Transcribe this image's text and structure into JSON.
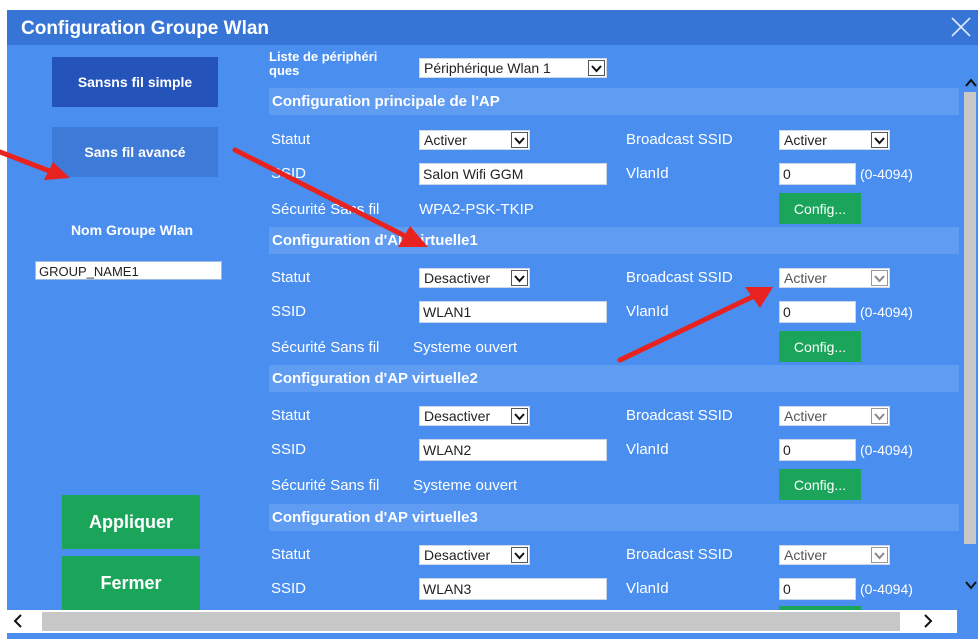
{
  "window": {
    "title": "Configuration Groupe Wlan"
  },
  "sidebar": {
    "simple_label": "Sansns fil simple",
    "advanced_label": "Sans fil avancé",
    "group_name_label": "Nom Groupe Wlan",
    "group_name_value": "GROUP_NAME1",
    "apply_label": "Appliquer",
    "close_label": "Fermer"
  },
  "device": {
    "label_line1": "Liste de périphéri",
    "label_line2": "ques",
    "selected": "Périphérique Wlan 1"
  },
  "sections": {
    "main": {
      "title": "Configuration principale de l'AP",
      "statut_label": "Statut",
      "statut": "Activer",
      "broadcast_label": "Broadcast SSID",
      "broadcast": "Activer",
      "ssid_label": "SSID",
      "ssid": "Salon Wifi GGM",
      "vlan_label": "VlanId",
      "vlan": "0",
      "range": "(0-4094)",
      "security_label": "Sécurité Sans fil",
      "security": "WPA2-PSK-TKIP",
      "config_label": "Config..."
    },
    "vap1": {
      "title": "Configuration d'AP virtuelle1",
      "statut_label": "Statut",
      "statut": "Desactiver",
      "broadcast_label": "Broadcast SSID",
      "broadcast": "Activer",
      "ssid_label": "SSID",
      "ssid": "WLAN1",
      "vlan_label": "VlanId",
      "vlan": "0",
      "range": "(0-4094)",
      "security_label": "Sécurité Sans fil",
      "security": "Systeme ouvert",
      "config_label": "Config..."
    },
    "vap2": {
      "title": "Configuration d'AP virtuelle2",
      "statut_label": "Statut",
      "statut": "Desactiver",
      "broadcast_label": "Broadcast SSID",
      "broadcast": "Activer",
      "ssid_label": "SSID",
      "ssid": "WLAN2",
      "vlan_label": "VlanId",
      "vlan": "0",
      "range": "(0-4094)",
      "security_label": "Sécurité Sans fil",
      "security": "Systeme ouvert",
      "config_label": "Config..."
    },
    "vap3": {
      "title": "Configuration d'AP virtuelle3",
      "statut_label": "Statut",
      "statut": "Desactiver",
      "broadcast_label": "Broadcast SSID",
      "broadcast": "Activer",
      "ssid_label": "SSID",
      "ssid": "WLAN3",
      "vlan_label": "VlanId",
      "vlan": "0",
      "range": "(0-4094)"
    }
  },
  "colors": {
    "dialog_bg": "#4a8ef0",
    "title_bar": "#3674d6",
    "button_green": "#1aa55b",
    "annotation_red": "#e8231f"
  }
}
